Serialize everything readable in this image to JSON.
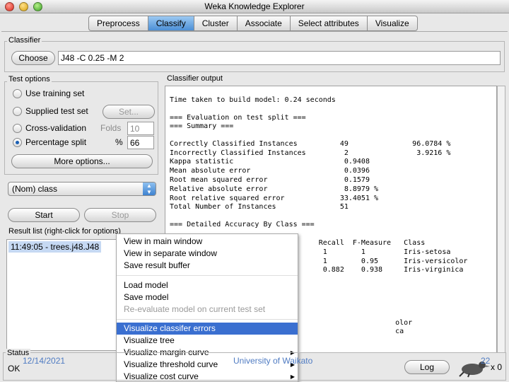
{
  "window": {
    "title": "Weka Knowledge Explorer"
  },
  "tabs": [
    {
      "label": "Preprocess",
      "active": false
    },
    {
      "label": "Classify",
      "active": true
    },
    {
      "label": "Cluster",
      "active": false
    },
    {
      "label": "Associate",
      "active": false
    },
    {
      "label": "Select attributes",
      "active": false
    },
    {
      "label": "Visualize",
      "active": false
    }
  ],
  "classifier": {
    "group_label": "Classifier",
    "choose_label": "Choose",
    "value": "J48 -C 0.25 -M 2"
  },
  "test_options": {
    "group_label": "Test options",
    "use_training_set": "Use training set",
    "supplied_test_set": "Supplied test set",
    "set_button": "Set...",
    "cross_validation": "Cross-validation",
    "folds_label": "Folds",
    "folds_value": "10",
    "percentage_split": "Percentage split",
    "percent_symbol": "%",
    "percent_value": "66",
    "more_options": "More options...",
    "selected": "percentage_split"
  },
  "class_select": {
    "value": "(Nom) class"
  },
  "actions": {
    "start": "Start",
    "stop": "Stop"
  },
  "result_list": {
    "group_label": "Result list (right-click for options)",
    "items": [
      "11:49:05 - trees.j48.J48"
    ]
  },
  "output": {
    "group_label": "Classifier output",
    "lines": [
      "Time taken to build model: 0.24 seconds",
      "",
      "=== Evaluation on test split ===",
      "=== Summary ===",
      "",
      "Correctly Classified Instances          49               96.0784 %",
      "Incorrectly Classified Instances         2                3.9216 %",
      "Kappa statistic                          0.9408",
      "Mean absolute error                      0.0396",
      "Root mean squared error                  0.1579",
      "Relative absolute error                  8.8979 %",
      "Root relative squared error             33.4051 %",
      "Total Number of Instances               51",
      "",
      "=== Detailed Accuracy By Class ===",
      "",
      "                                   Recall  F-Measure   Class",
      "                                    1        1         Iris-setosa",
      "                                    1        0.95      Iris-versicolor",
      "                                    0.882    0.938     Iris-virginica",
      "",
      "",
      "",
      "",
      "                                                     olor",
      "                                                     ca"
    ]
  },
  "context_menu": {
    "items": [
      {
        "label": "View in main window",
        "enabled": true
      },
      {
        "label": "View in separate window",
        "enabled": true
      },
      {
        "label": "Save result buffer",
        "enabled": true
      },
      {
        "label": "Load model",
        "enabled": true
      },
      {
        "label": "Save model",
        "enabled": true
      },
      {
        "label": "Re-evaluate model on current test set",
        "enabled": false
      },
      {
        "label": "Visualize classifer errors",
        "enabled": true,
        "highlighted": true
      },
      {
        "label": "Visualize tree",
        "enabled": true
      },
      {
        "label": "Visualize margin curve",
        "enabled": true,
        "submenu": true
      },
      {
        "label": "Visualize threshold curve",
        "enabled": true,
        "submenu": true
      },
      {
        "label": "Visualize cost curve",
        "enabled": true,
        "submenu": true
      }
    ]
  },
  "status": {
    "group_label": "Status",
    "text": "OK",
    "log_button": "Log",
    "x_count": "x 0"
  },
  "slide_footer": {
    "date": "12/14/2021",
    "center": "University of Waikato",
    "page": "22"
  },
  "colors": {
    "accent": "#3a6fd0",
    "tab_active": "#6aa8e6",
    "footer_text": "#4f7bc2"
  }
}
